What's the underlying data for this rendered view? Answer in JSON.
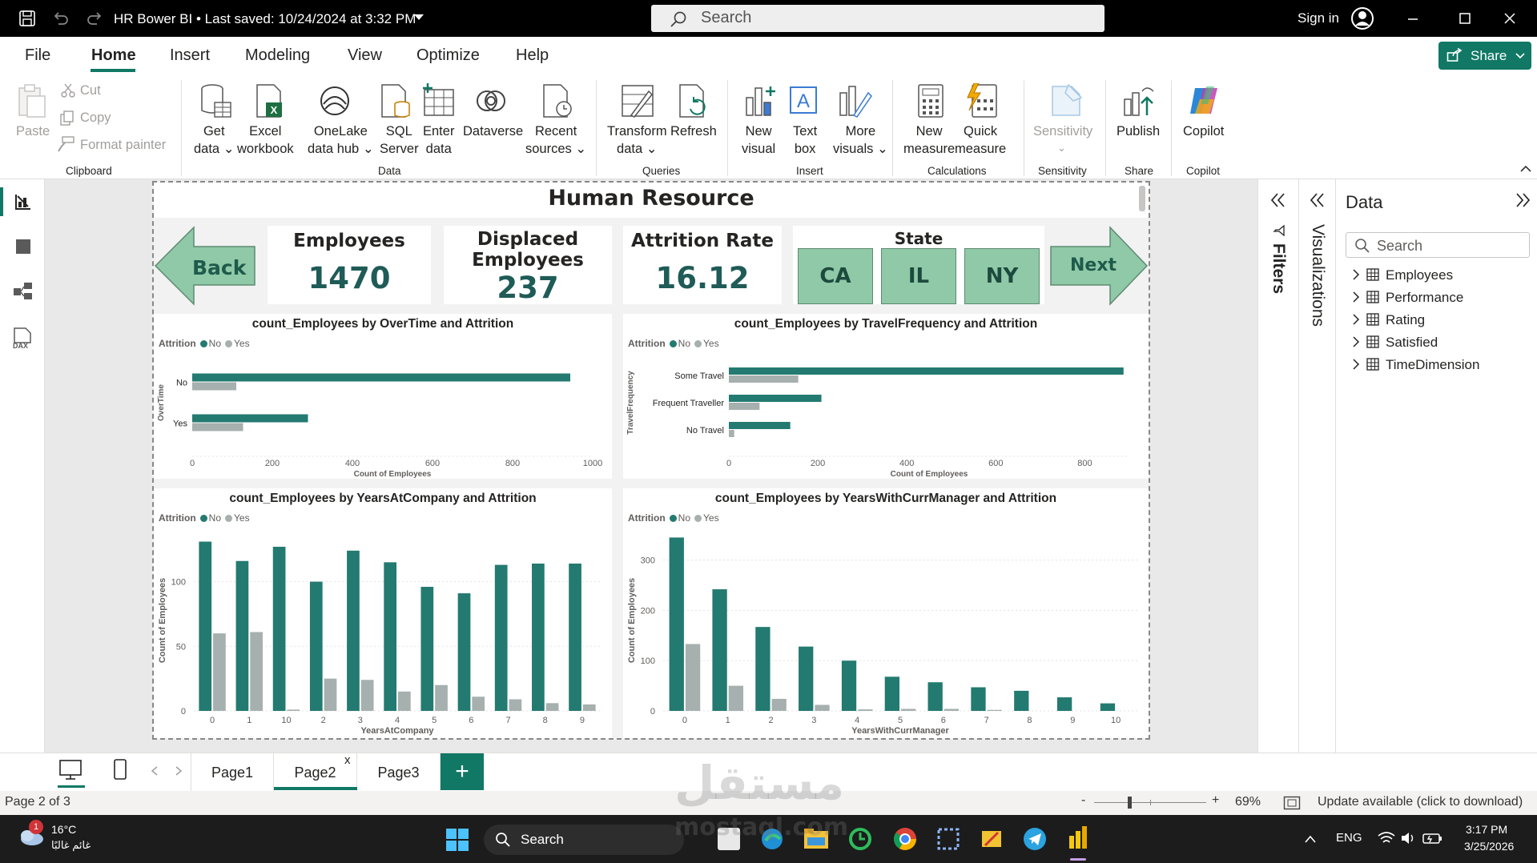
{
  "titlebar": {
    "title": "HR Bower BI",
    "separator": "•",
    "last_saved": "Last saved: 10/24/2024 at 3:32 PM",
    "search_placeholder": "Search",
    "sign_in": "Sign in"
  },
  "menu": {
    "items": [
      "File",
      "Home",
      "Insert",
      "Modeling",
      "View",
      "Optimize",
      "Help"
    ],
    "active": "Home",
    "share_label": "Share"
  },
  "ribbon": {
    "clipboard": {
      "paste": "Paste",
      "cut": "Cut",
      "copy": "Copy",
      "format_painter": "Format painter",
      "group": "Clipboard"
    },
    "data": {
      "get_data": [
        "Get",
        "data"
      ],
      "excel": [
        "Excel",
        "workbook"
      ],
      "onelake": [
        "OneLake",
        "data hub"
      ],
      "sql": [
        "SQL",
        "Server"
      ],
      "enter": [
        "Enter",
        "data"
      ],
      "dataverse": "Dataverse",
      "recent": [
        "Recent",
        "sources"
      ],
      "group": "Data"
    },
    "queries": {
      "transform": [
        "Transform",
        "data"
      ],
      "refresh": "Refresh",
      "group": "Queries"
    },
    "insert": {
      "new_visual": [
        "New",
        "visual"
      ],
      "text_box": [
        "Text",
        "box"
      ],
      "more_visuals": [
        "More",
        "visuals"
      ],
      "group": "Insert"
    },
    "calculations": {
      "new_measure": [
        "New",
        "measure"
      ],
      "quick_measure": [
        "Quick",
        "measure"
      ],
      "group": "Calculations"
    },
    "sensitivity": {
      "label": "Sensitivity",
      "group": "Sensitivity"
    },
    "share": {
      "publish": "Publish",
      "group": "Share"
    },
    "copilot": {
      "label": "Copilot",
      "group": "Copilot"
    }
  },
  "report": {
    "title": "Human Resource",
    "back_label": "Back",
    "next_label": "Next",
    "kpis": [
      {
        "title": "Employees",
        "value": "1470"
      },
      {
        "title": "Displaced Employees",
        "value": "237"
      },
      {
        "title": "Attrition Rate",
        "value": "16.12"
      }
    ],
    "state": {
      "title": "State",
      "options": [
        "CA",
        "IL",
        "NY"
      ]
    }
  },
  "legend": {
    "title": "Attrition",
    "no": "No",
    "yes": "Yes"
  },
  "colors": {
    "no": "#237a70",
    "yes": "#a6b0ae",
    "accent": "#117865",
    "state_button": "#8fc9a7"
  },
  "chart_data": [
    {
      "type": "bar",
      "orientation": "horizontal",
      "title": "count_Employees by OverTime and Attrition",
      "xlabel": "Count of Employees",
      "ylabel": "OverTime",
      "categories": [
        "No",
        "Yes"
      ],
      "series": [
        {
          "name": "No",
          "values": [
            944,
            289
          ]
        },
        {
          "name": "Yes",
          "values": [
            110,
            127
          ]
        }
      ],
      "xlim": [
        0,
        1000
      ],
      "xticks": [
        "0",
        "200",
        "400",
        "600",
        "800",
        "1000"
      ],
      "legend": "top-left"
    },
    {
      "type": "bar",
      "orientation": "horizontal",
      "title": "count_Employees by TravelFrequency and Attrition",
      "xlabel": "Count of Employees",
      "ylabel": "TravelFrequency",
      "categories": [
        "Some Travel",
        "Frequent Traveller",
        "No Travel"
      ],
      "series": [
        {
          "name": "No",
          "values": [
            887,
            208,
            138
          ]
        },
        {
          "name": "Yes",
          "values": [
            156,
            69,
            12
          ]
        }
      ],
      "xlim": [
        0,
        900
      ],
      "xticks": [
        "0",
        "200",
        "400",
        "600",
        "800"
      ],
      "legend": "top-left"
    },
    {
      "type": "bar",
      "title": "count_Employees by YearsAtCompany and Attrition",
      "xlabel": "YearsAtCompany",
      "ylabel": "Count of Employees",
      "categories": [
        "0",
        "1",
        "10",
        "2",
        "3",
        "4",
        "5",
        "6",
        "7",
        "8",
        "9"
      ],
      "series": [
        {
          "name": "No",
          "values": [
            131,
            116,
            127,
            100,
            124,
            115,
            96,
            91,
            113,
            114,
            114
          ]
        },
        {
          "name": "Yes",
          "values": [
            60,
            61,
            1,
            25,
            24,
            15,
            20,
            11,
            9,
            6,
            5
          ]
        }
      ],
      "ylim": [
        0,
        140
      ],
      "yticks": [
        "0",
        "50",
        "100"
      ],
      "legend": "top-left"
    },
    {
      "type": "bar",
      "title": "count_Employees by YearsWithCurrManager and Attrition",
      "xlabel": "YearsWithCurrManager",
      "ylabel": "Count of Employees",
      "categories": [
        "0",
        "1",
        "2",
        "3",
        "4",
        "5",
        "6",
        "7",
        "8",
        "9",
        "10"
      ],
      "series": [
        {
          "name": "No",
          "values": [
            345,
            242,
            167,
            128,
            100,
            68,
            57,
            47,
            40,
            27,
            15
          ]
        },
        {
          "name": "Yes",
          "values": [
            133,
            50,
            24,
            12,
            3,
            4,
            4,
            2,
            0,
            0,
            0
          ]
        }
      ],
      "ylim": [
        0,
        360
      ],
      "yticks": [
        "0",
        "100",
        "200",
        "300"
      ],
      "legend": "top-left"
    }
  ],
  "panes": {
    "filters": "Filters",
    "visualizations": "Visualizations",
    "data_title": "Data",
    "search_placeholder": "Search",
    "tables": [
      "Employees",
      "Performance",
      "Rating",
      "Satisfied",
      "TimeDimension"
    ]
  },
  "pages": {
    "tabs": [
      "Page1",
      "Page2",
      "Page3"
    ],
    "active": "Page2",
    "add": "+"
  },
  "status": {
    "page": "Page 2 of 3",
    "zoom_minus": "-",
    "zoom_plus": "+",
    "zoom": "69%",
    "update": "Update available (click to download)"
  },
  "taskbar": {
    "temp": "16°C",
    "weather": "غائم غالبًا",
    "badge": "1",
    "search": "Search",
    "lang": "ENG",
    "time": "3:17 PM",
    "date": "3/25/2026"
  },
  "watermark": {
    "arabic": "مستقل",
    "latin": "mostaql.com"
  }
}
